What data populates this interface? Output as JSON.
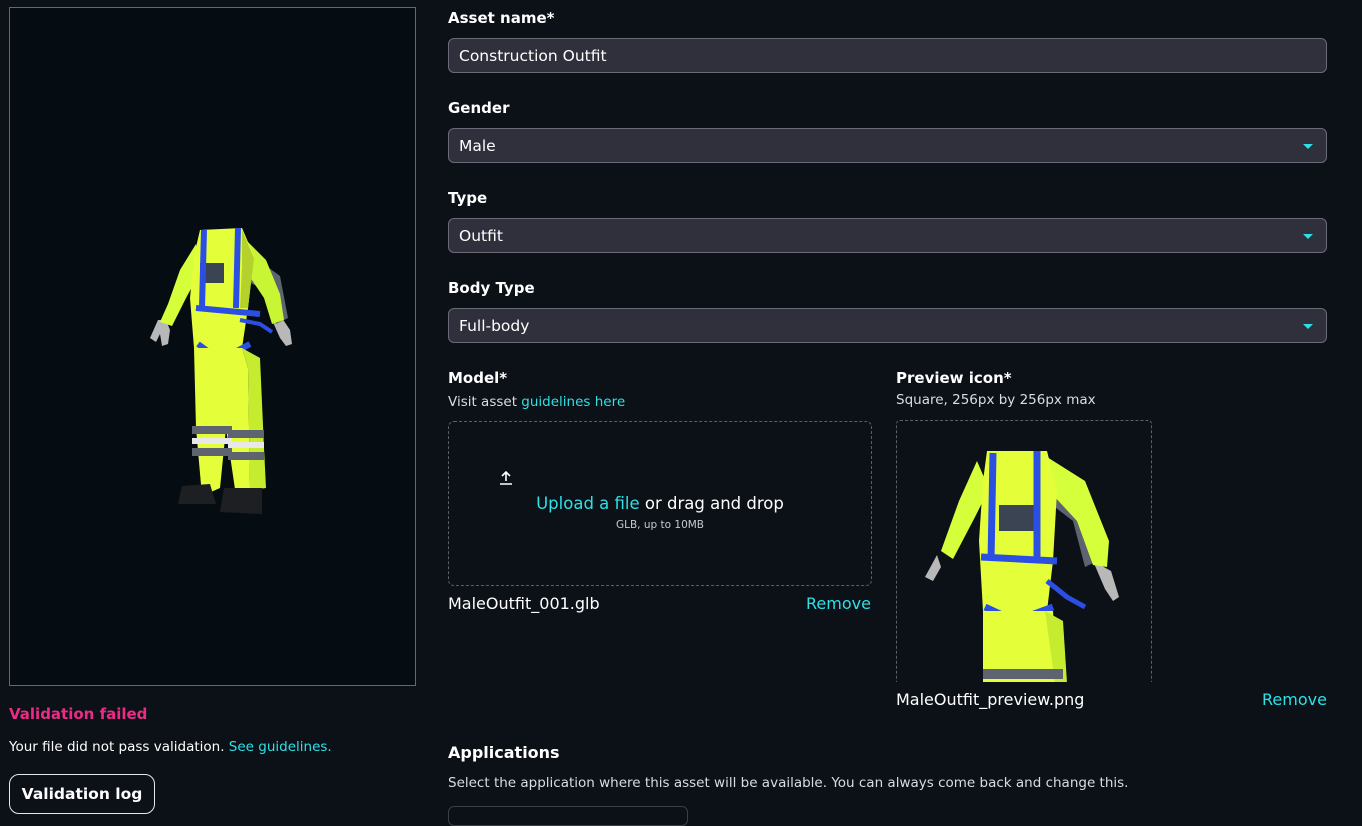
{
  "validation": {
    "title": "Validation failed",
    "message": "Your file did not pass validation.",
    "guidelines_link": "See guidelines.",
    "log_button": "Validation log"
  },
  "form": {
    "asset_name": {
      "label": "Asset name*",
      "value": "Construction Outfit"
    },
    "gender": {
      "label": "Gender",
      "value": "Male"
    },
    "type": {
      "label": "Type",
      "value": "Outfit"
    },
    "body_type": {
      "label": "Body Type",
      "value": "Full-body"
    },
    "model": {
      "label": "Model*",
      "hint_prefix": "Visit asset",
      "hint_link": "guidelines here",
      "upload_link": "Upload a file",
      "upload_rest": "or drag and drop",
      "upload_hint": "GLB, up to 10MB",
      "file_name": "MaleOutfit_001.glb",
      "remove": "Remove"
    },
    "preview_icon": {
      "label": "Preview icon*",
      "hint": "Square, 256px by 256px max",
      "file_name": "MaleOutfit_preview.png",
      "remove": "Remove"
    },
    "applications": {
      "label": "Applications",
      "description": "Select the application where this asset will be available. You can always come back and change this."
    }
  },
  "colors": {
    "accent": "#2de1e6",
    "error": "#ec2b86",
    "background": "#0b1117",
    "field": "#302f3c"
  },
  "icons": [
    "upload-icon",
    "chevron-down-icon"
  ]
}
